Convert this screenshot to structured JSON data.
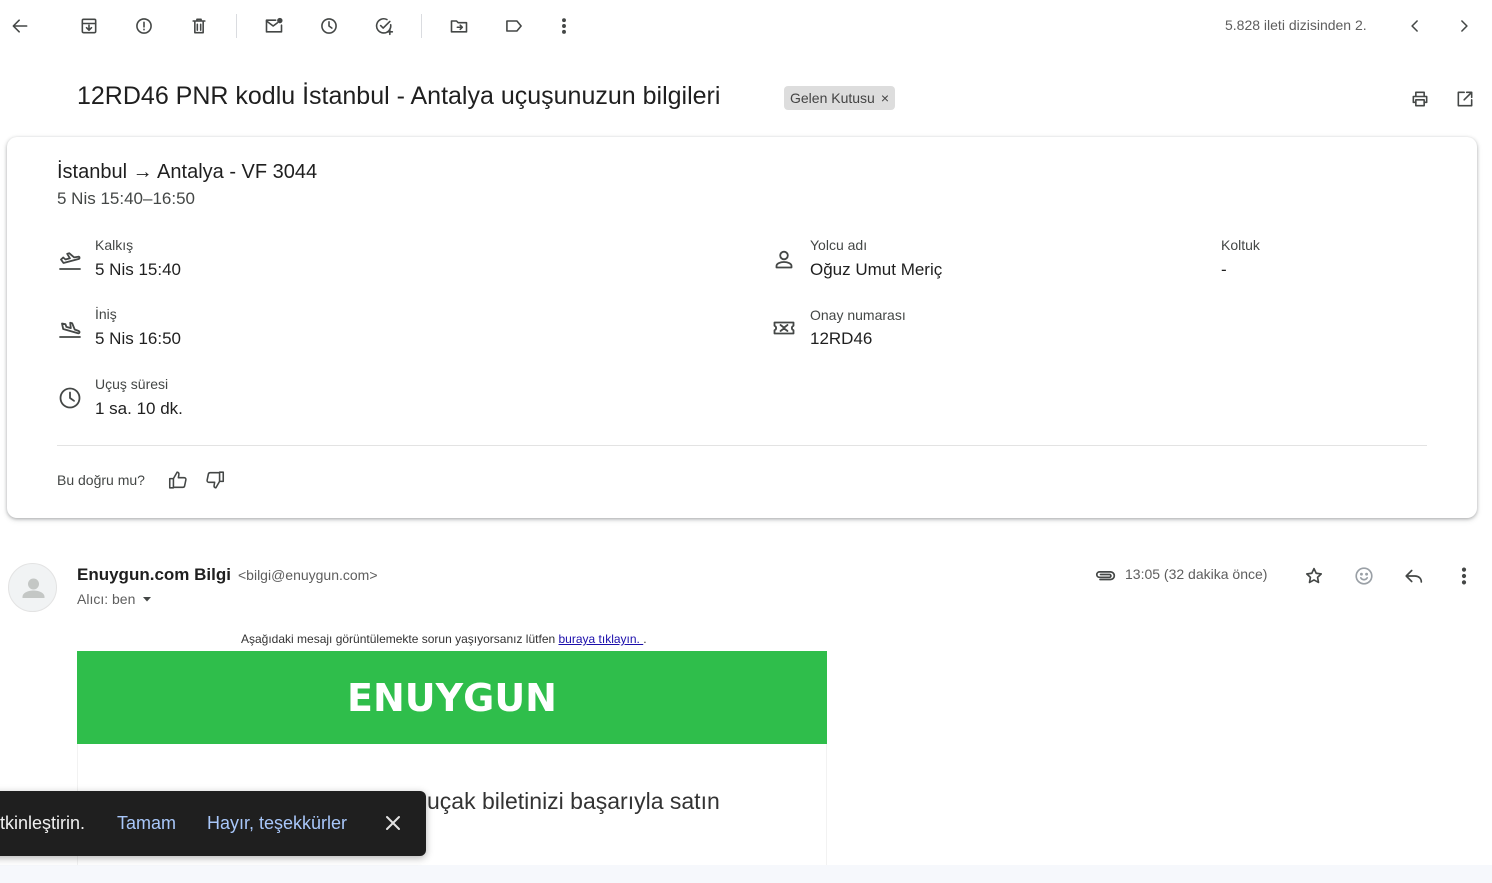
{
  "toolbar": {
    "back": "arrow-back-icon",
    "archive": "archive-icon",
    "spam": "report-spam-icon",
    "delete": "trash-icon",
    "mark_unread": "mark-unread-icon",
    "snooze": "clock-icon",
    "add_task": "add-task-icon",
    "move": "move-to-folder-icon",
    "labels": "label-icon",
    "more": "more-vert-icon",
    "pagination": "5.828 ileti dizisinden 2.",
    "prev": "chevron-left-icon",
    "next": "chevron-right-icon"
  },
  "subject": "12RD46 PNR kodlu İstanbul - Antalya uçuşunuzun bilgileri",
  "label_chip": {
    "text": "Gelen Kutusu",
    "remove": "×"
  },
  "header_actions": {
    "print": "print-icon",
    "open_new": "open-in-new-icon"
  },
  "flight_card": {
    "title": "İstanbul → Antalya - VF 3044",
    "subtitle": "5 Nis 15:40–16:50",
    "departure": {
      "label": "Kalkış",
      "value": "5 Nis 15:40"
    },
    "arrival": {
      "label": "İniş",
      "value": "5 Nis 16:50"
    },
    "duration": {
      "label": "Uçuş süresi",
      "value": "1 sa. 10 dk."
    },
    "passenger": {
      "label": "Yolcu adı",
      "value": "Oğuz Umut Meriç"
    },
    "seat": {
      "label": "Koltuk",
      "value": "-"
    },
    "confirmation": {
      "label": "Onay numarası",
      "value": "12RD46"
    },
    "feedback_question": "Bu doğru mu?"
  },
  "message": {
    "sender_name": "Enuygun.com Bilgi",
    "sender_email": "<bilgi@enuygun.com>",
    "recipient": "Alıcı: ben",
    "time": "13:05 (32 dakika önce)"
  },
  "email_content": {
    "preheader": "Aşağıdaki mesajı görüntülemekte sorun yaşıyorsanız lütfen ",
    "preheader_link": "buraya tıklayın. ",
    "preheader_end": ".",
    "logo_text": "ENUYGUN",
    "brand_color": "#2fbe4b",
    "body_line": "uçak biletinizi başarıyla satın"
  },
  "snackbar": {
    "text": "tkinleştirin.",
    "ok": "Tamam",
    "no": "Hayır, teşekkürler"
  }
}
